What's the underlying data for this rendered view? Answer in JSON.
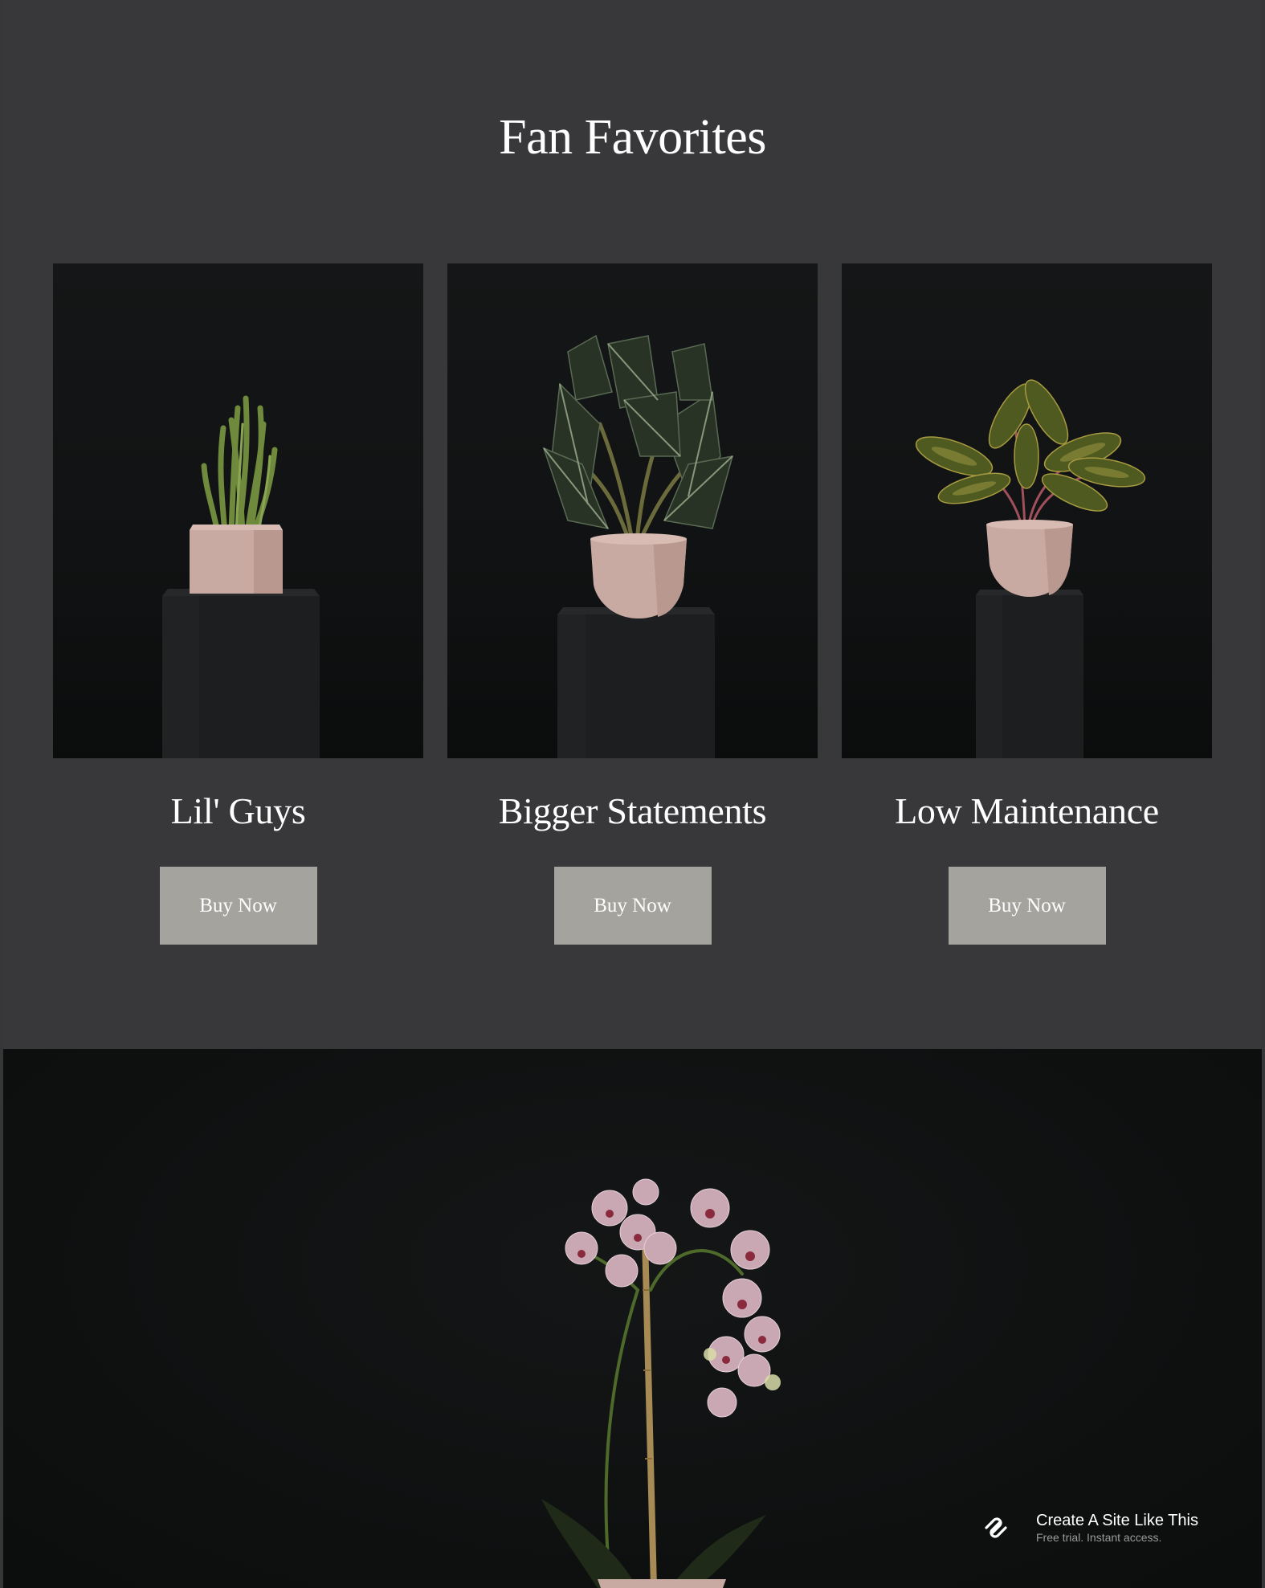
{
  "favorites": {
    "title": "Fan Favorites",
    "cards": [
      {
        "name": "Lil' Guys",
        "button_label": "Buy Now",
        "image": "cactus-in-square-pink-pot-on-black-pedestal"
      },
      {
        "name": "Bigger Statements",
        "button_label": "Buy Now",
        "image": "alocasia-in-round-pink-pot-on-black-pedestal"
      },
      {
        "name": "Low Maintenance",
        "button_label": "Buy Now",
        "image": "aglaonema-in-round-pink-pot-on-black-pedestal"
      }
    ]
  },
  "hero": {
    "image": "pink-orchid-on-dark-background"
  },
  "promo_badge": {
    "title": "Create A Site Like This",
    "subtitle": "Free trial. Instant access.",
    "icon": "squarespace-logo-icon"
  },
  "colors": {
    "section_background": "#38383b",
    "hero_background": "#0e1010",
    "button_background": "#a4a39e",
    "text": "#ffffff",
    "muted_text": "#9a9a9a",
    "pot_pink": "#c9aaa2"
  }
}
